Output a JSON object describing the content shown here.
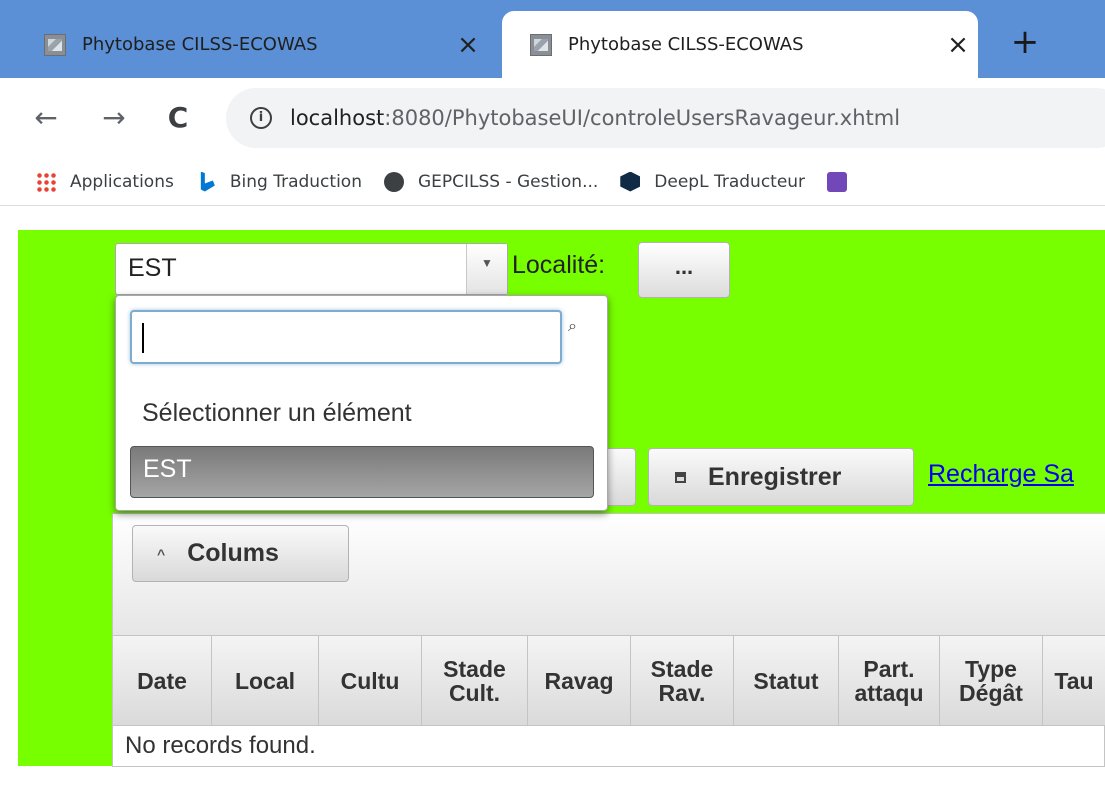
{
  "browser": {
    "tabs": [
      {
        "title": "Phytobase CILSS-ECOWAS",
        "close": "×",
        "active": false
      },
      {
        "title": "Phytobase CILSS-ECOWAS",
        "close": "×",
        "active": true
      }
    ],
    "new_tab": "+",
    "nav": {
      "back": "←",
      "forward": "→",
      "reload": "C"
    },
    "address": {
      "info": "i",
      "host": "localhost",
      "path": ":8080/PhytobaseUI/controleUsersRavageur.xhtml"
    },
    "bookmarks": [
      {
        "label": "Applications",
        "icon": "apps-icon"
      },
      {
        "label": "Bing Traduction",
        "icon": "bing-icon"
      },
      {
        "label": "GEPCILSS - Gestion...",
        "icon": "globe-icon"
      },
      {
        "label": "DeepL Traducteur",
        "icon": "deepl-icon"
      },
      {
        "label": "",
        "icon": "forms-icon"
      }
    ]
  },
  "form": {
    "region_value": "EST",
    "locality_label": "Localité:",
    "locality_button": "...",
    "save_button": "Enregistrer",
    "recharge_link": "Recharge Sa"
  },
  "dropdown": {
    "search_value": "",
    "items": [
      "Sélectionner un élément",
      "EST"
    ],
    "selected": "EST"
  },
  "table": {
    "columns_button": "Colums",
    "headers": [
      "Date",
      "Local",
      "Cultu",
      "Stade\nCult.",
      "Ravag",
      "Stade\nRav.",
      "Statut",
      "Part.\nattaqu",
      "Type\nDégât",
      "Tau"
    ],
    "empty_message": "No records found."
  },
  "colors": {
    "page_background": "#77ff00",
    "tab_strip": "#5b8fd6",
    "link": "#0000ee"
  }
}
